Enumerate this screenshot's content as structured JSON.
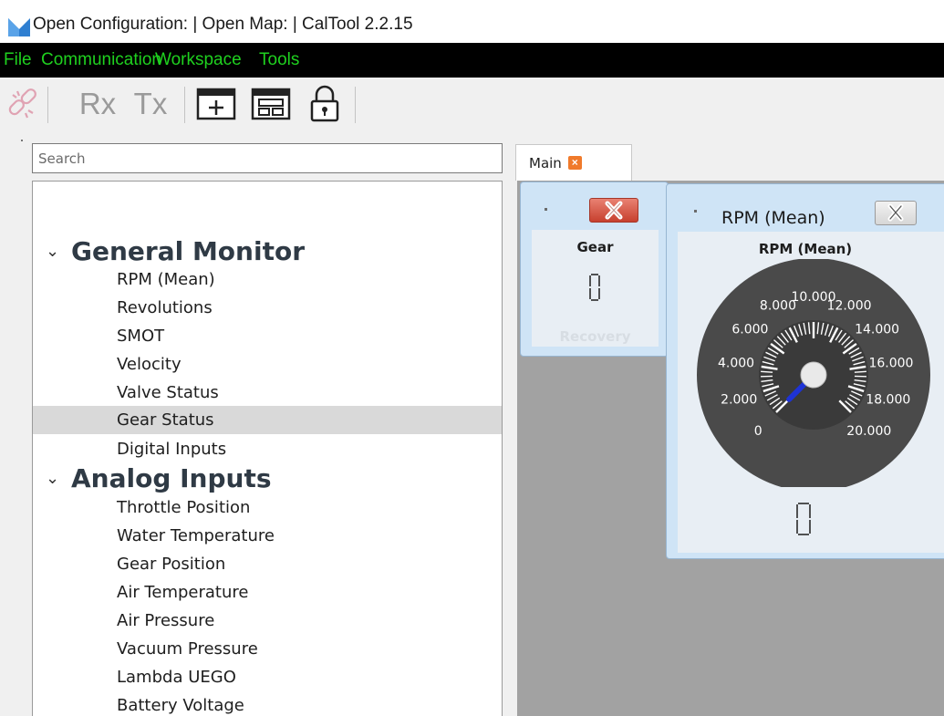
{
  "window": {
    "title": "Open Configuration:  |  Open Map:  | CalTool 2.2.15"
  },
  "menu": {
    "items": [
      "File",
      "Communication",
      "Workspace",
      "Tools"
    ]
  },
  "toolbar": {
    "connect_icon": "broken-link-icon",
    "rx_label": "Rx",
    "tx_label": "Tx",
    "add_window_icon": "add-window-icon",
    "layout_icon": "layout-window-icon",
    "lock_icon": "padlock-icon"
  },
  "sidebar": {
    "search": {
      "placeholder": "Search",
      "value": ""
    },
    "groups": [
      {
        "label": "General Monitor",
        "items": [
          "RPM (Mean)",
          "Revolutions",
          "SMOT",
          "Velocity",
          "Valve Status",
          "Gear Status",
          "Digital Inputs"
        ]
      },
      {
        "label": "Analog Inputs",
        "items": [
          "Throttle Position",
          "Water Temperature",
          "Gear Position",
          "Air Temperature",
          "Air Pressure",
          "Vacuum Pressure",
          "Lambda UEGO",
          "Battery Voltage"
        ]
      }
    ],
    "selected_item": "Gear Status"
  },
  "tabs": [
    {
      "label": "Main",
      "active": true
    }
  ],
  "widgets": {
    "gear": {
      "title": "Gear",
      "value": "0",
      "subtitle": "Recovery"
    },
    "rpm": {
      "header": "RPM (Mean)",
      "title": "RPM (Mean)",
      "value": "0",
      "gauge": {
        "min": 0,
        "max": 20000,
        "current": 0,
        "tick_labels": [
          "0",
          "2.000",
          "4.000",
          "6.000",
          "8.000",
          "10.000",
          "12.000",
          "14.000",
          "16.000",
          "18.000",
          "20.000"
        ],
        "needle_color": "#1e33d6",
        "face_color": "#4a4a4a"
      }
    }
  },
  "colors": {
    "menu_text": "#1fd11f",
    "menu_bg": "#000000",
    "close_accent": "#f07a2b",
    "close_red": "#c7402e"
  }
}
